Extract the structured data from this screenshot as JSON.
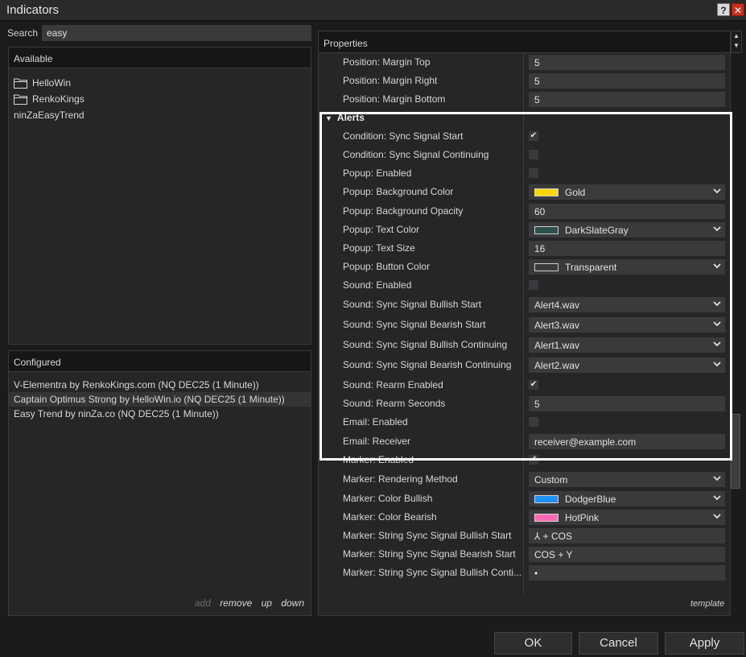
{
  "window": {
    "title": "Indicators",
    "help_label": "?",
    "close_label": "✕"
  },
  "search": {
    "label": "Search",
    "value": "easy"
  },
  "available": {
    "header": "Available",
    "items": [
      {
        "label": "HelloWin",
        "icon": "folder-icon"
      },
      {
        "label": "RenkoKings",
        "icon": "folder-icon"
      },
      {
        "label": "ninZaEasyTrend",
        "icon": ""
      }
    ]
  },
  "configured": {
    "header": "Configured",
    "items": [
      {
        "label": "V-Elementra by RenkoKings.com (NQ DEC25 (1 Minute))",
        "selected": false
      },
      {
        "label": "Captain Optimus Strong by HelloWin.io (NQ DEC25 (1 Minute))",
        "selected": true
      },
      {
        "label": "Easy Trend by ninZa.co (NQ DEC25 (1 Minute))",
        "selected": false
      }
    ],
    "links": {
      "add": "add",
      "remove": "remove",
      "up": "up",
      "down": "down"
    }
  },
  "properties": {
    "header": "Properties",
    "scroll_up": "▲",
    "scroll_down": "▼",
    "rows": [
      {
        "label": "Position: Margin Top",
        "type": "text",
        "value": "5"
      },
      {
        "label": "Position: Margin Right",
        "type": "text",
        "value": "5"
      },
      {
        "label": "Position: Margin Bottom",
        "type": "text",
        "value": "5"
      },
      {
        "label": "Alerts",
        "type": "category"
      },
      {
        "label": "Condition: Sync Signal Start",
        "type": "check",
        "checked": true
      },
      {
        "label": "Condition: Sync Signal Continuing",
        "type": "check",
        "checked": false
      },
      {
        "label": "Popup: Enabled",
        "type": "check",
        "checked": false
      },
      {
        "label": "Popup: Background Color",
        "type": "color",
        "value": "Gold",
        "color": "#FFD700"
      },
      {
        "label": "Popup: Background Opacity",
        "type": "text",
        "value": "60"
      },
      {
        "label": "Popup: Text Color",
        "type": "color",
        "value": "DarkSlateGray",
        "color": "#2F4F4F"
      },
      {
        "label": "Popup: Text Size",
        "type": "text",
        "value": "16"
      },
      {
        "label": "Popup: Button Color",
        "type": "color",
        "value": "Transparent",
        "color": "transparent"
      },
      {
        "label": "Sound: Enabled",
        "type": "check",
        "checked": false
      },
      {
        "label": "Sound: Sync Signal Bullish Start",
        "type": "select",
        "value": "Alert4.wav"
      },
      {
        "label": "Sound: Sync Signal Bearish Start",
        "type": "select",
        "value": "Alert3.wav"
      },
      {
        "label": "Sound: Sync Signal Bullish Continuing",
        "type": "select",
        "value": "Alert1.wav"
      },
      {
        "label": "Sound: Sync Signal Bearish Continuing",
        "type": "select",
        "value": "Alert2.wav"
      },
      {
        "label": "Sound: Rearm Enabled",
        "type": "check",
        "checked": true
      },
      {
        "label": "Sound: Rearm Seconds",
        "type": "text",
        "value": "5"
      },
      {
        "label": "Email: Enabled",
        "type": "check",
        "checked": false
      },
      {
        "label": "Email: Receiver",
        "type": "text",
        "value": "receiver@example.com"
      },
      {
        "label": "Marker: Enabled",
        "type": "check",
        "checked": true
      },
      {
        "label": "Marker: Rendering Method",
        "type": "select",
        "value": "Custom"
      },
      {
        "label": "Marker: Color Bullish",
        "type": "color",
        "value": "DodgerBlue",
        "color": "#1E90FF"
      },
      {
        "label": "Marker: Color Bearish",
        "type": "color",
        "value": "HotPink",
        "color": "#FF69B4"
      },
      {
        "label": "Marker: String Sync Signal Bullish Start",
        "type": "text",
        "value": "⅄ + COS"
      },
      {
        "label": "Marker: String Sync Signal Bearish Start",
        "type": "text",
        "value": "COS + Y"
      },
      {
        "label": "Marker: String Sync Signal Bullish Conti...",
        "type": "text",
        "value": "•"
      }
    ],
    "template_link": "template"
  },
  "buttons": {
    "ok": "OK",
    "cancel": "Cancel",
    "apply": "Apply"
  }
}
